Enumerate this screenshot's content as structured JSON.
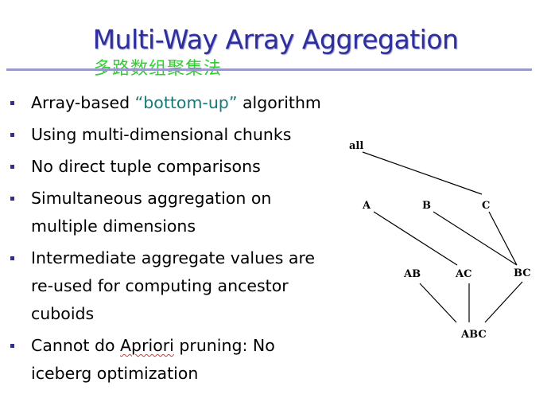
{
  "slide": {
    "title": "Multi-Way Array Aggregation",
    "subtitle": "多路数组聚集法"
  },
  "bullets": [
    {
      "pre": "Array-based ",
      "highlight": "“bottom-up”",
      "post": " algorithm"
    },
    {
      "text": "Using multi-dimensional chunks"
    },
    {
      "text": "No direct tuple comparisons"
    },
    {
      "line1": "Simultaneous aggregation on",
      "line2": "multiple dimensions"
    },
    {
      "line1": "Intermediate aggregate values are",
      "line2": "re-used for computing ancestor",
      "line3": "cuboids"
    },
    {
      "pre": "Cannot do ",
      "misspelled": "Apriori",
      "post": " pruning: No",
      "line2": "iceberg optimization"
    }
  ],
  "lattice": {
    "nodes": [
      "all",
      "A",
      "B",
      "C",
      "AB",
      "AC",
      "BC",
      "ABC"
    ],
    "edges": [
      [
        "all",
        "C"
      ],
      [
        "A",
        "AC"
      ],
      [
        "B",
        "BC"
      ],
      [
        "C",
        "BC"
      ],
      [
        "AB",
        "ABC"
      ],
      [
        "AC",
        "ABC"
      ],
      [
        "BC",
        "ABC"
      ]
    ]
  },
  "colors": {
    "title": "#2e2e9c",
    "subtitle": "#33cc33",
    "highlight": "#157a7a",
    "bullet": "#2e2e9c",
    "rule": "#9999cc"
  }
}
